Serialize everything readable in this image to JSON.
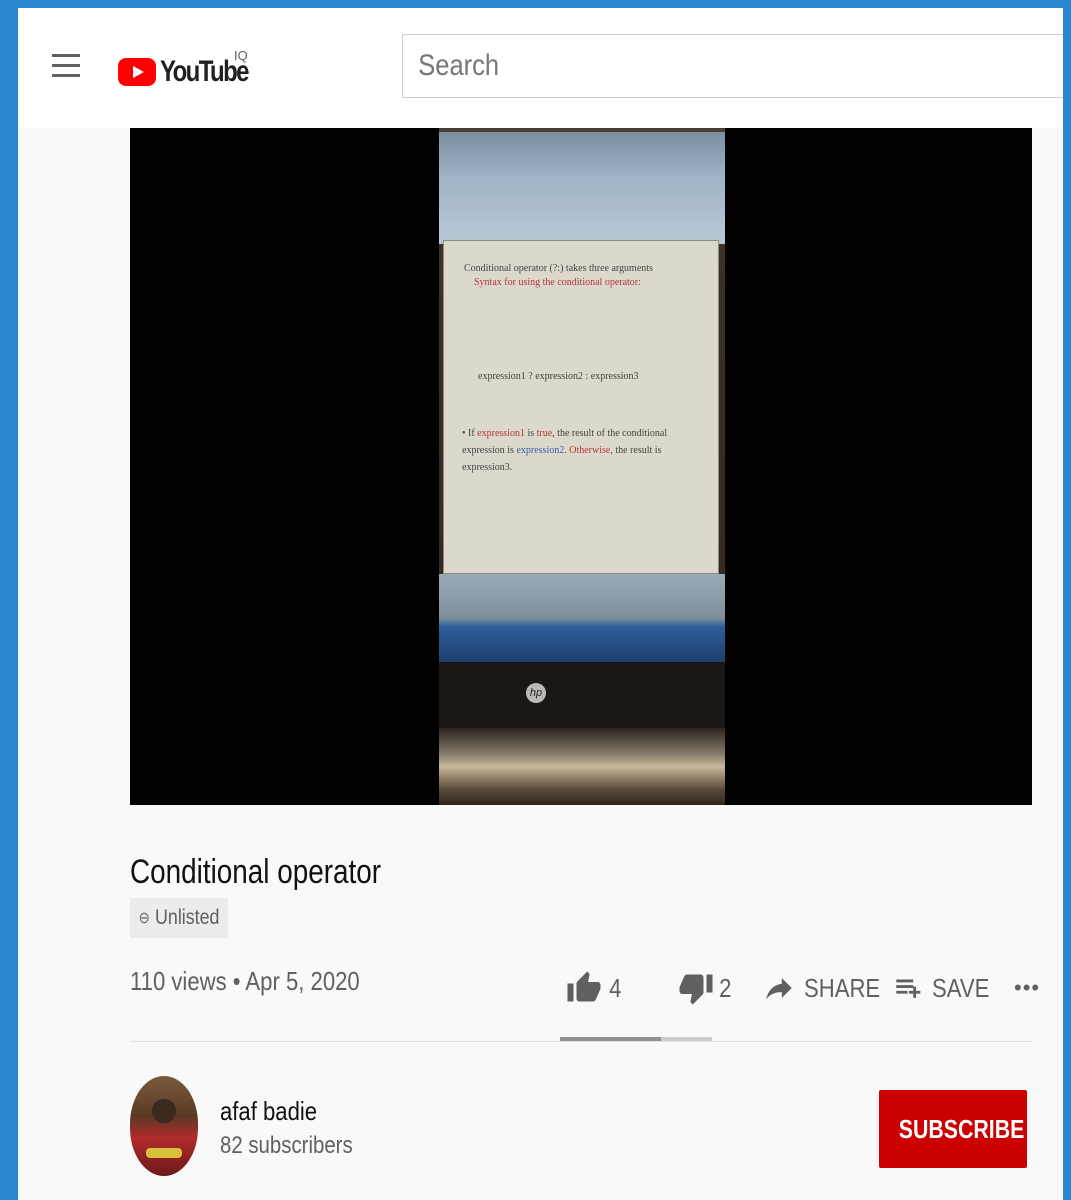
{
  "header": {
    "logo_text": "YouTube",
    "logo_superscript": "IQ",
    "search_placeholder": "Search"
  },
  "video": {
    "title": "Conditional operator",
    "visibility": "Unlisted",
    "views_date": "110 views • Apr 5, 2020",
    "slide": {
      "line1": "Conditional operator (?:) takes three arguments",
      "line2": "Syntax for using the conditional operator:",
      "line3": "expression1 ? expression2 : expression3",
      "bullet_pre": "• If ",
      "bullet_expr1": "expression1",
      "bullet_mid1": " is ",
      "bullet_true": "true",
      "bullet_mid2": ", the result of the conditional expression is ",
      "bullet_expr2": "expression2",
      "bullet_mid3": ". ",
      "bullet_otherwise": "Otherwise",
      "bullet_end": ", the result is expression3."
    }
  },
  "actions": {
    "like_count": "4",
    "dislike_count": "2",
    "share_label": "SHARE",
    "save_label": "SAVE",
    "more_label": "•••",
    "like_ratio": 0.667
  },
  "channel": {
    "name": "afaf badie",
    "subscribers": "82 subscribers",
    "subscribe_label": "SUBSCRIBE"
  },
  "colors": {
    "brand_red": "#ff0000",
    "subscribe_bg": "#cc0000",
    "frame_blue": "#2a86cf"
  },
  "icons": [
    "menu-icon",
    "youtube-logo",
    "link-icon",
    "thumbs-up-icon",
    "thumbs-down-icon",
    "share-arrow-icon",
    "playlist-add-icon",
    "more-icon"
  ]
}
